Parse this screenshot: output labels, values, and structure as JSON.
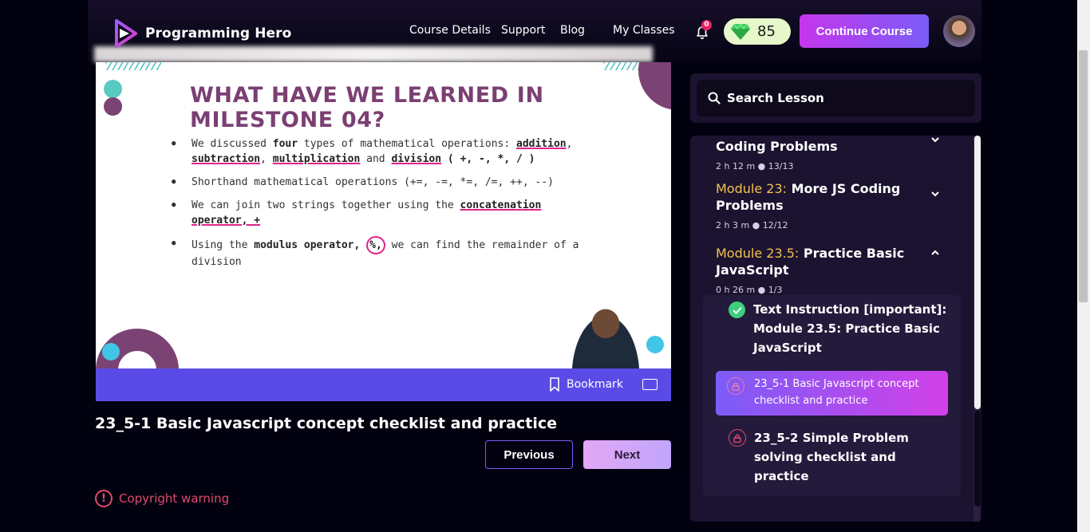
{
  "header": {
    "brand": "Programming Hero",
    "nav": [
      "Course Details",
      "Support",
      "Blog",
      "My Classes"
    ],
    "notification_count": "0",
    "gems": "85",
    "continue_label": "Continue Course"
  },
  "slide": {
    "title": "WHAT HAVE WE LEARNED IN MILESTONE 04?",
    "bullet1_a": "We discussed ",
    "bullet1_b": "four",
    "bullet1_c": " types of mathematical operations: ",
    "bullet1_d": "addition",
    "bullet1_e": ", ",
    "bullet1_f": "subtraction",
    "bullet1_g": ", ",
    "bullet1_h": "multiplication",
    "bullet1_i": " and ",
    "bullet1_j": "division",
    "bullet1_k": " ( +, -, *, / )",
    "bullet2": "Shorthand mathematical operations (+=, -=, *=, /=, ++, --)",
    "bullet3_a": "We can join two strings together using the ",
    "bullet3_b": "concatenation operator, +",
    "bullet4_a": "Using the ",
    "bullet4_b": "modulus operator, ",
    "bullet4_c": "%,",
    "bullet4_d": " we can find the remainder of a division"
  },
  "player": {
    "bookmark_label": "Bookmark"
  },
  "lesson": {
    "title": "23_5-1 Basic Javascript concept checklist and practice",
    "previous_label": "Previous",
    "next_label": "Next",
    "copyright_label": "Copyright warning"
  },
  "sidebar": {
    "search_placeholder": "Search Lesson",
    "modules": [
      {
        "title_tail": "Coding Problems",
        "meta": "2 h 12 m ●  13/13"
      },
      {
        "num": "Module 23:",
        "title": " More JS Coding Problems",
        "meta": "2 h 3 m ●  12/12"
      },
      {
        "num": "Module 23.5:",
        "title": " Practice Basic JavaScript",
        "meta": "0 h 26 m ●  1/3"
      }
    ],
    "lessons": [
      {
        "title": "Text Instruction [important]: Module 23.5: Practice Basic JavaScript"
      },
      {
        "title": "23_5-1 Basic Javascript concept checklist and practice"
      },
      {
        "title": "23_5-2 Simple Problem solving checklist and practice"
      }
    ]
  },
  "colors": {
    "accent": "#7b5cf7",
    "module_number": "#f3c24d",
    "video_bar": "#5b4be6",
    "warning": "#e04a6c"
  }
}
